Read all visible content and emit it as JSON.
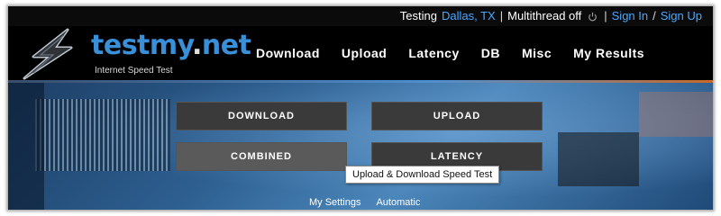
{
  "status_bar": {
    "testing_label": "Testing",
    "location": "Dallas, TX",
    "separator": "|",
    "multithread": "Multithread off",
    "sign_in": "Sign In",
    "slash": "/",
    "sign_up": "Sign Up"
  },
  "brand": {
    "logo_name": "testmy",
    "logo_dot": ".",
    "logo_tld": "net",
    "tagline": "Internet Speed Test"
  },
  "nav": {
    "items": [
      {
        "label": "Download"
      },
      {
        "label": "Upload"
      },
      {
        "label": "Latency"
      },
      {
        "label": "DB"
      },
      {
        "label": "Misc"
      },
      {
        "label": "My Results"
      }
    ]
  },
  "tests": {
    "download": "DOWNLOAD",
    "upload": "UPLOAD",
    "combined": "COMBINED",
    "latency": "LATENCY"
  },
  "tooltip": "Upload & Download Speed Test",
  "footer_links": {
    "settings": "My Settings",
    "mode": "Automatic"
  },
  "colors": {
    "link_blue": "#4aa7ff",
    "brand_blue": "#3a8fd9",
    "button_bg": "#3a3a3a",
    "header_bg": "#000000"
  },
  "icons": {
    "power": "power-icon",
    "logo": "lightning-bolt-logo-icon"
  }
}
